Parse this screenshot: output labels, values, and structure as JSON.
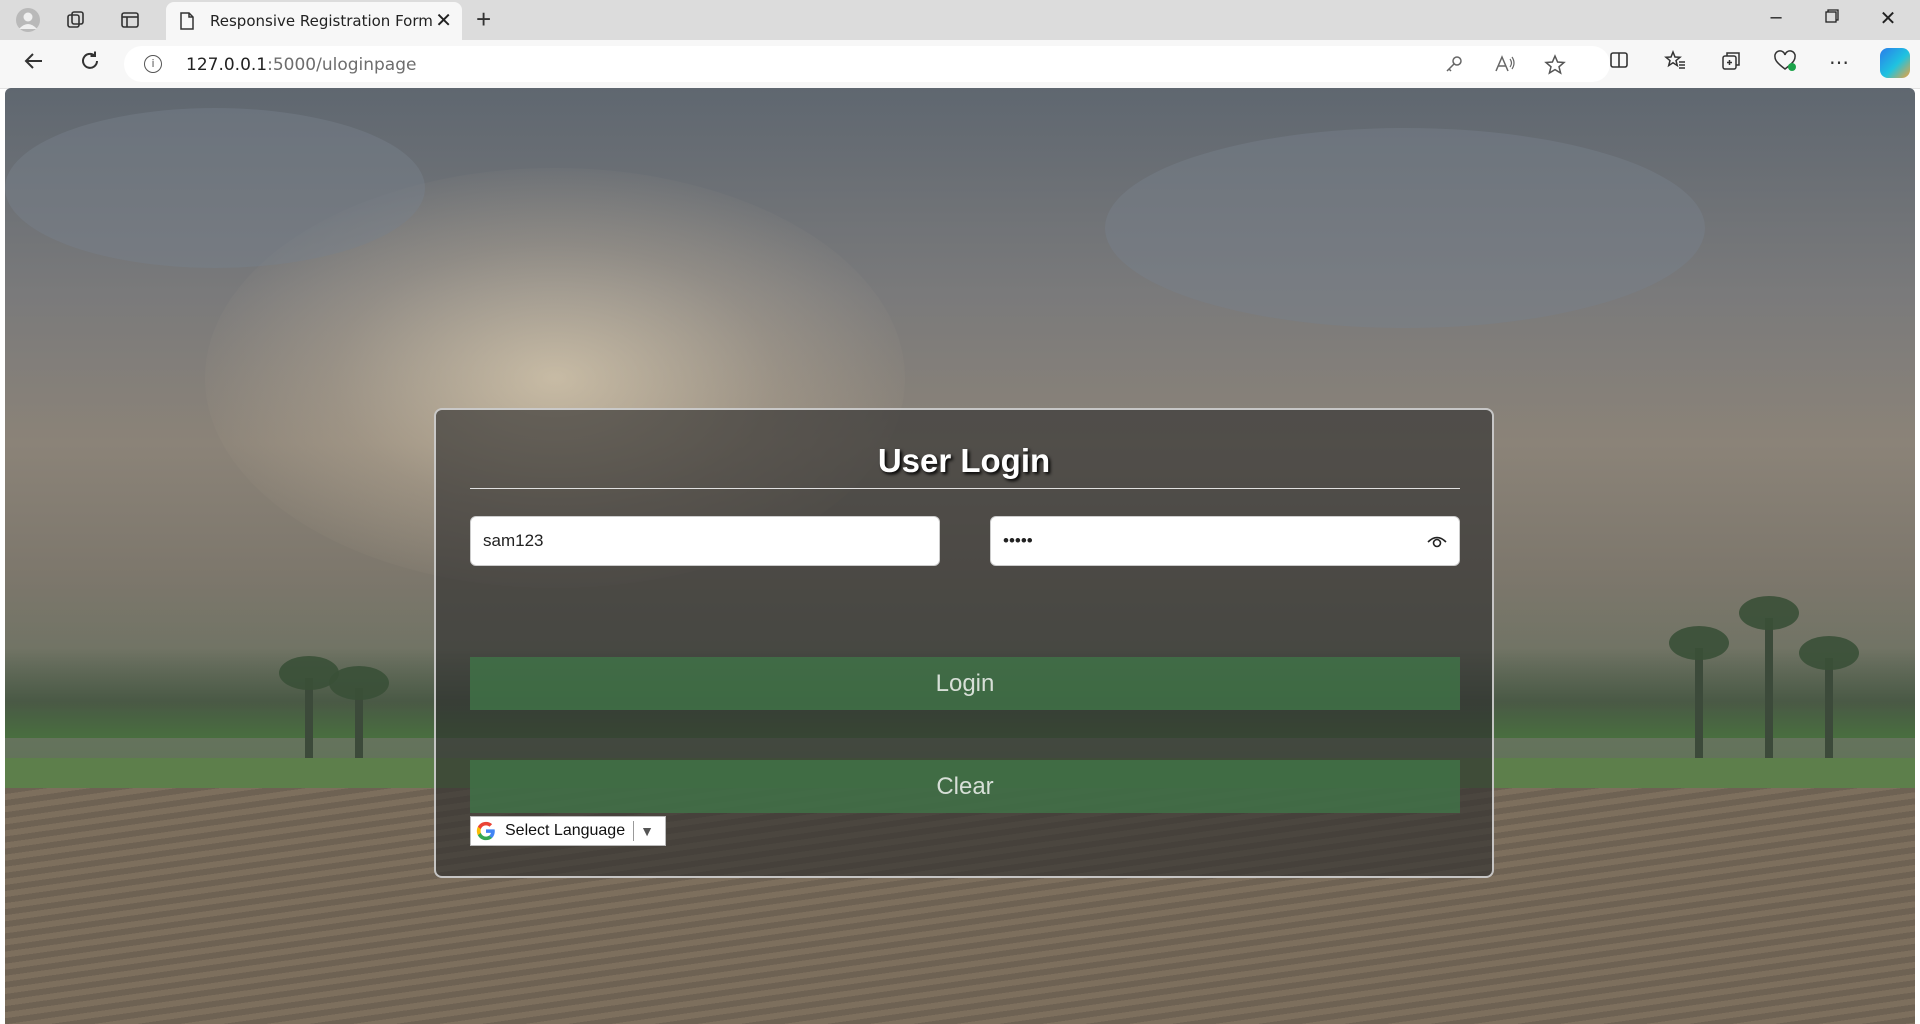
{
  "browser": {
    "tab_title": "Responsive Registration Form",
    "url_host": "127.0.0.1",
    "url_rest": ":5000/uloginpage",
    "close_glyph": "✕",
    "new_tab_glyph": "+"
  },
  "login_form": {
    "title": "User Login",
    "username_value": "sam123",
    "password_masked": "•••••",
    "login_label": "Login",
    "clear_label": "Clear"
  },
  "translate": {
    "label": "Select Language",
    "arrow": "▼"
  },
  "colors": {
    "button_green": "#407648",
    "card_bg": "#2d2d2d"
  }
}
